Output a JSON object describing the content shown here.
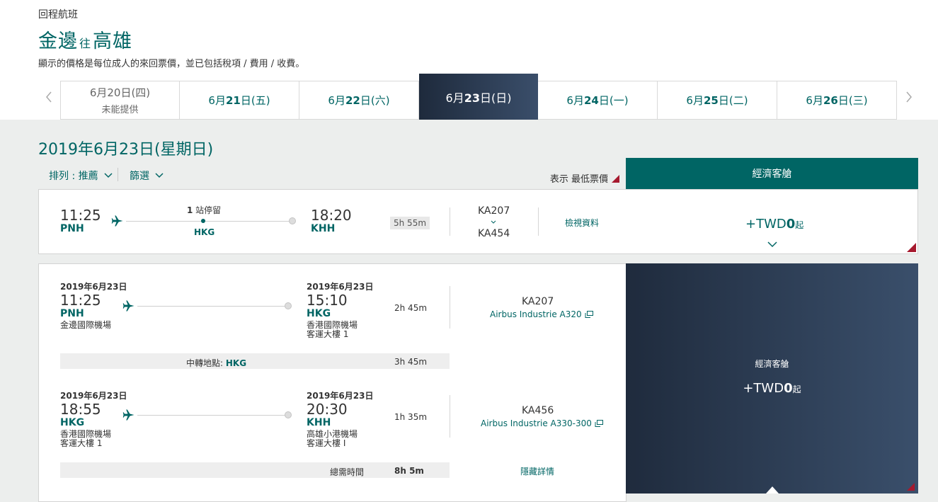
{
  "header": {
    "label": "回程航班",
    "origin": "金邊",
    "connector": "往",
    "destination": "高雄",
    "note": "顯示的價格是每位成人的來回票價，並已包括稅項 / 費用 / 收費。"
  },
  "date_tabs": [
    {
      "month": "6月",
      "day": "20",
      "suffix": "日(四)",
      "sub": "未能提供"
    },
    {
      "month": "6月",
      "day": "21",
      "suffix": "日(五)",
      "sub": ""
    },
    {
      "month": "6月",
      "day": "22",
      "suffix": "日(六)",
      "sub": ""
    },
    {
      "month": "6月",
      "day": "23",
      "suffix": "日(日)",
      "sub": ""
    },
    {
      "month": "6月",
      "day": "24",
      "suffix": "日(一)",
      "sub": ""
    },
    {
      "month": "6月",
      "day": "25",
      "suffix": "日(二)",
      "sub": ""
    },
    {
      "month": "6月",
      "day": "26",
      "suffix": "日(三)",
      "sub": ""
    }
  ],
  "results": {
    "selected_date": "2019年6月23日(星期日)",
    "sort_label": "排列 : 推薦",
    "filter_label": "篩選",
    "show_lowest": "表示 最低票價",
    "cabin_header": "經濟客艙"
  },
  "summary": {
    "depart_time": "11:25",
    "depart_code": "PNH",
    "stops_count": "1",
    "stops_label": " 站停留",
    "stop_code": "HKG",
    "arrive_time": "18:20",
    "arrive_code": "KHH",
    "duration": "5h 55m",
    "flight1": "KA207",
    "flight2": "KA454",
    "details_link": "檢視資料",
    "price_prefix": "+TWD",
    "price_amount": "0",
    "price_suffix": "起"
  },
  "details": {
    "segments": [
      {
        "depart_date": "2019年6月23日",
        "depart_time": "11:25",
        "depart_code": "PNH",
        "depart_airport": "金邊國際機場",
        "depart_terminal": "",
        "arrive_date": "2019年6月23日",
        "arrive_time": "15:10",
        "arrive_code": "HKG",
        "arrive_airport": "香港國際機場",
        "arrive_terminal": "客運大樓 1",
        "duration": "2h 45m",
        "flight": "KA207",
        "aircraft": "Airbus Industrie A320"
      },
      {
        "depart_date": "2019年6月23日",
        "depart_time": "18:55",
        "depart_code": "HKG",
        "depart_airport": "香港國際機場",
        "depart_terminal": "客運大樓 1",
        "arrive_date": "2019年6月23日",
        "arrive_time": "20:30",
        "arrive_code": "KHH",
        "arrive_airport": "高雄小港機場",
        "arrive_terminal": "客運大樓 I",
        "duration": "1h 35m",
        "flight": "KA456",
        "aircraft": "Airbus Industrie A330-300"
      }
    ],
    "transfer_label": "中轉地點",
    "transfer_code": "HKG",
    "transfer_duration": "3h 45m",
    "total_label": "總需時間",
    "total_duration": "8h 5m",
    "hide_link": "隱藏詳情",
    "cabin_label": "經濟客艙",
    "price_prefix": "+TWD",
    "price_amount": "0",
    "price_suffix": "起"
  },
  "colors": {
    "brand_teal": "#006564",
    "navy": "#1f2b3d",
    "accent_red": "#a6192e"
  }
}
